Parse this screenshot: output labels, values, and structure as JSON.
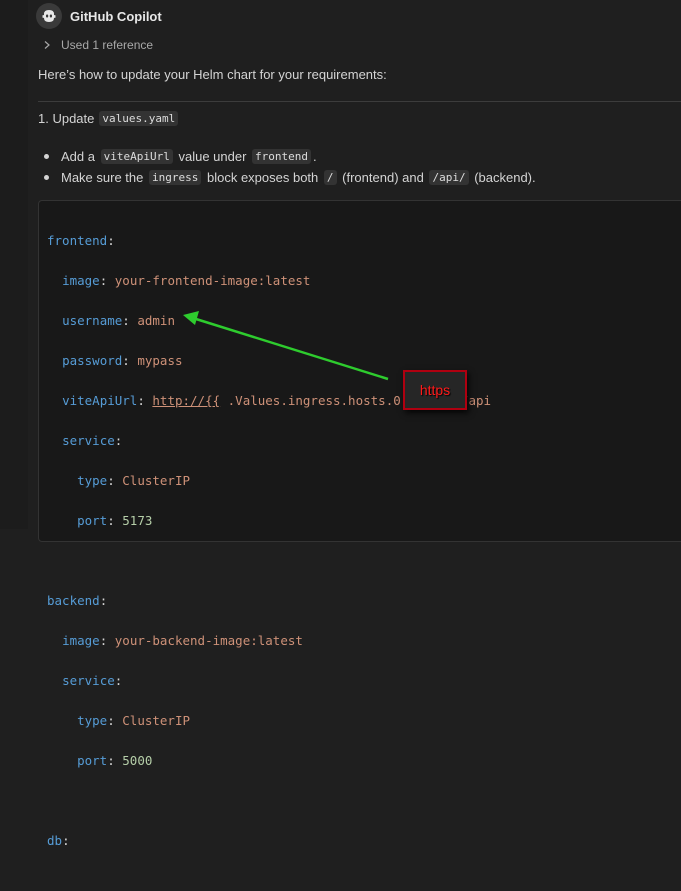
{
  "header": {
    "name": "GitHub Copilot",
    "avatar_icon": "copilot-icon"
  },
  "reference": {
    "label": "Used 1 reference"
  },
  "intro": "Here’s how to update your Helm chart for your requirements:",
  "step": {
    "number": "1. Update",
    "file": "values.yaml"
  },
  "bullets": [
    {
      "pre": "Add a",
      "code": "viteApiUrl",
      "mid": "value under",
      "code2": "frontend",
      "post": "."
    },
    {
      "pre": "Make sure the",
      "code": "ingress",
      "mid": "block exposes both",
      "code2": "/",
      "mid2": "(frontend) and",
      "code3": "/api/",
      "post": "(backend)."
    }
  ],
  "code": {
    "frontend_key": "frontend",
    "image_key": "image",
    "frontend_image": "your-frontend-image:latest",
    "username_key": "username",
    "username": "admin",
    "password_key": "password",
    "password": "mypass",
    "vite_key": "viteApiUrl",
    "vite_link": "http://{{",
    "vite_rest": " .Values.ingress.hosts.0.host }}/api",
    "service_key": "service",
    "type_key": "type",
    "frontend_type": "ClusterIP",
    "port_key": "port",
    "frontend_port": "5173",
    "backend_key": "backend",
    "backend_image": "your-backend-image:latest",
    "backend_type": "ClusterIP",
    "backend_port": "5000",
    "db_key": "db"
  },
  "annotation": {
    "label": "https",
    "color": "#ff1a1a",
    "arrow_color": "#2ecc2e"
  },
  "colors": {
    "key": "#569cd6",
    "string": "#ce9178",
    "number": "#b5cea8",
    "background": "#1f1f1f"
  }
}
